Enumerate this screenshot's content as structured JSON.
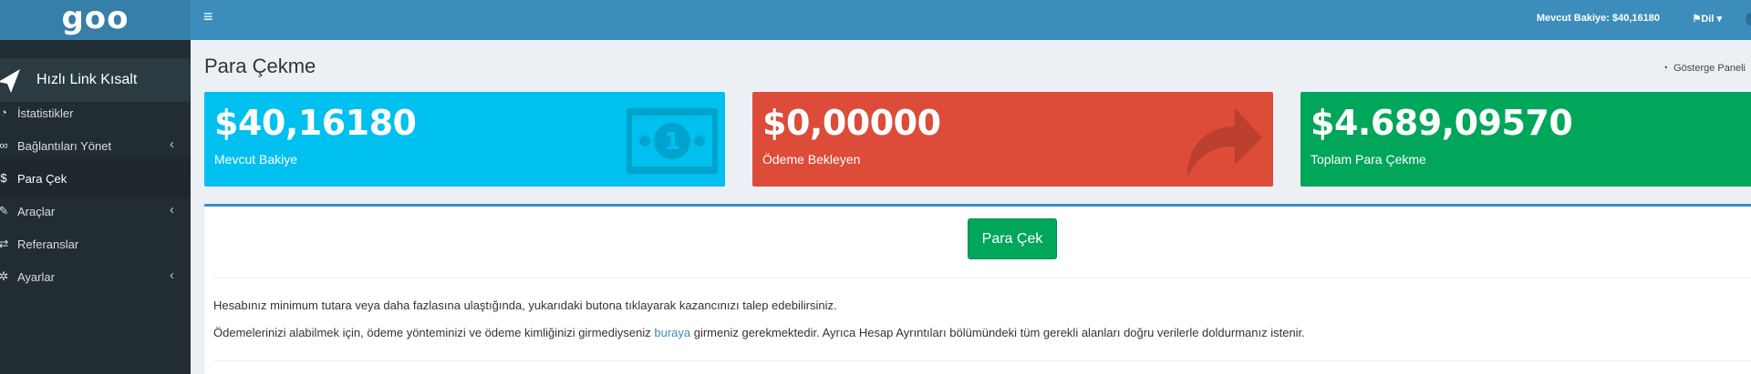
{
  "header": {
    "logo": "goo",
    "balance_text": "Mevcut Bakiye: $40,16180",
    "language_label": "Dil ▾"
  },
  "sidebar": {
    "brand_label": "Hızlı Link Kısalt",
    "items": [
      {
        "label": "İstatistikler",
        "icon": "dashboard-icon",
        "has_submenu": false
      },
      {
        "label": "Bağlantıları Yönet",
        "icon": "link-icon",
        "has_submenu": true
      },
      {
        "label": "Para Çek",
        "icon": "dollar-icon",
        "has_submenu": false,
        "active": true
      },
      {
        "label": "Araçlar",
        "icon": "wrench-icon",
        "has_submenu": true
      },
      {
        "label": "Referanslar",
        "icon": "exchange-icon",
        "has_submenu": false
      },
      {
        "label": "Ayarlar",
        "icon": "gears-icon",
        "has_submenu": true
      }
    ]
  },
  "page": {
    "title": "Para Çekme",
    "dashboard_link": "Gösterge Paneli"
  },
  "stats": [
    {
      "value": "$40,16180",
      "label": "Mevcut Bakiye",
      "color": "#00c0ef",
      "icon": "money-icon"
    },
    {
      "value": "$0,00000",
      "label": "Ödeme Bekleyen",
      "color": "#dd4b39",
      "icon": "share-icon"
    },
    {
      "value": "$4.689,09570",
      "label": "Toplam Para Çekme",
      "color": "#00a65a",
      "icon": "none"
    }
  ],
  "withdraw": {
    "button_label": "Para Çek",
    "info_line1": "Hesabınız minimum tutara veya daha fazlasına ulaştığında, yukarıdaki butona tıklayarak kazancınızı talep edebilirsiniz.",
    "info_line2_before": "Ödemelerinizi alabilmek için, ödeme yönteminizi ve ödeme kimliğinizi girmediyseniz ",
    "info_line2_link": "buraya",
    "info_line2_after": " girmeniz gerekmektedir. Ayrıca Hesap Ayrıntıları bölümündeki tüm gerekli alanları doğru verilerle doldurmanız istenir."
  },
  "colors": {
    "header": "#3c8dbc",
    "logo_bg": "#367fa9",
    "sidebar": "#222d32",
    "accent_green": "#00a65a"
  }
}
